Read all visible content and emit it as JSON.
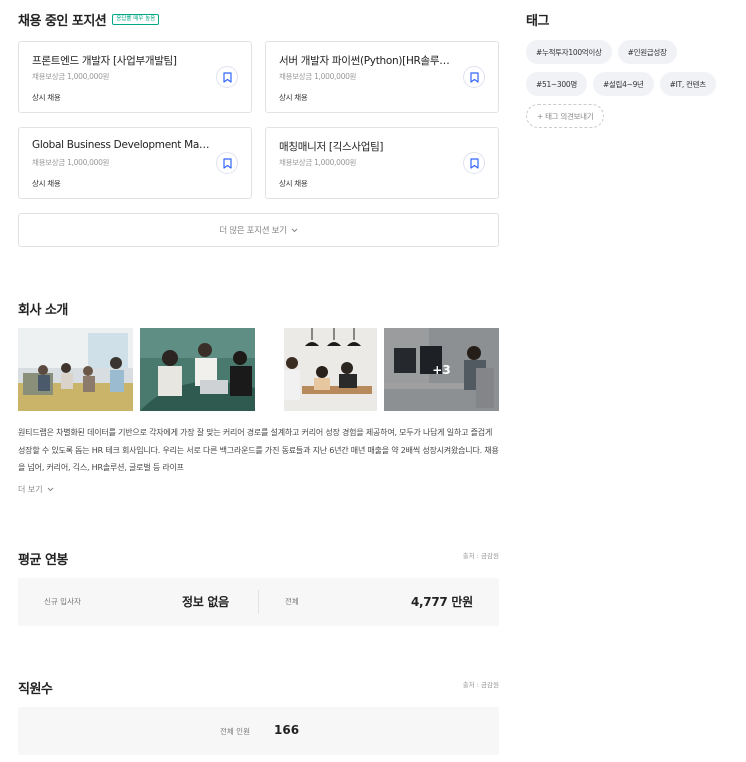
{
  "positions": {
    "title": "채용 중인 포지션",
    "badge": "응답률 매우 높음",
    "cards": [
      {
        "title": "프론트엔드 개발자 [사업부개발팀]",
        "reward": "채용보상금 1,000,000원",
        "type": "상시 채용"
      },
      {
        "title": "서버 개발자 파이썬(Python)[HR솔루션팀]",
        "reward": "채용보상금 1,000,000원",
        "type": "상시 채용"
      },
      {
        "title": "Global Business Development Manager",
        "reward": "채용보상금 1,000,000원",
        "type": "상시 채용"
      },
      {
        "title": "매칭매니저 [긱스사업팀]",
        "reward": "채용보상금 1,000,000원",
        "type": "상시 채용"
      }
    ],
    "more_label": "더 많은 포지션 보기"
  },
  "intro": {
    "title": "회사 소개",
    "photo_more": "+3",
    "text": "원티드랩은 차별화된 데이터를 기반으로 각자에게 가장 잘 맞는 커리어 경로를 설계하고 커리어 성장 경험을 제공하여, 모두가 나답게 일하고 즐겁게 성장할 수 있도록 돕는 HR 테크 회사입니다. 우리는 서로 다른 백그라운드를 가진 동료들과 지난 6년간 매년 매출을 약 2배씩 성장시켜왔습니다. 채용을 넘어, 커리어, 긱스, HR솔루션, 글로벌 등 라이프",
    "more_label": "더 보기"
  },
  "salary": {
    "title": "평균 연봉",
    "source": "출처 : 금감원",
    "new_label": "신규 입사자",
    "new_value": "정보 없음",
    "total_label": "전체",
    "total_value": "4,777",
    "unit": "만원"
  },
  "employees": {
    "title": "직원수",
    "source": "출처 : 금감원",
    "label": "전체 인원",
    "value": "166"
  },
  "tags": {
    "title": "태그",
    "items": [
      "#누적투자100억이상",
      "#인원급성장",
      "#51~300명",
      "#설립4~9년",
      "#IT, 컨텐츠"
    ],
    "add_label": "+ 태그 의견보내기"
  },
  "colors": {
    "accent": "#3366ff",
    "badge": "#00a884"
  }
}
